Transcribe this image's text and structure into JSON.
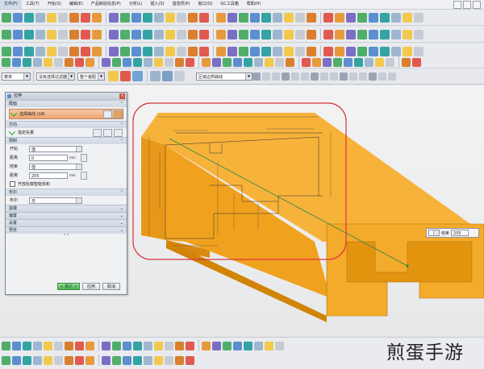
{
  "menu": [
    "文件(F)",
    "工具(T)",
    "开始(S)",
    "编辑(E)",
    "产品制造信息(P)",
    "分析(L)",
    "插入(S)",
    "首选项(P)",
    "窗口(O)",
    "GC工具箱",
    "帮助(H)"
  ],
  "selection_bar": {
    "filter_left": "菜单",
    "snap_filter": "没有选择过滤器",
    "scope_filter": "整个装配",
    "curve_rule": "区域边界曲线"
  },
  "dialog": {
    "title": "拉伸",
    "sections": {
      "section": "截面",
      "direction": "方向",
      "limits": "限制",
      "boolean": "布尔",
      "draft": "拔模",
      "offset": "偏置",
      "settings": "设置",
      "preview": "预览"
    },
    "select_curve": "选择曲线 (18)",
    "specify_vector": "指定矢量",
    "start_label": "开始",
    "start_value": "值",
    "distance_label": "距离",
    "start_distance": "0",
    "end_label": "结束",
    "end_value": "值",
    "end_distance": "205",
    "unit": "mm",
    "open_profile": "开放轮廓智能体积",
    "boolean_label": "布尔",
    "boolean_value": "无",
    "ok": "< 确定 >",
    "apply": "应用",
    "cancel": "取消"
  },
  "floating_input": {
    "label": "结束",
    "value": "205"
  },
  "watermark": "煎蛋手游",
  "colors": {
    "part_top": "#f7b23a",
    "part_side": "#f0a21e",
    "part_dark": "#d88a10",
    "highlight_ring": "#d8343e",
    "dimension": "#3a3a3a",
    "selected_curve": "#efa776"
  }
}
